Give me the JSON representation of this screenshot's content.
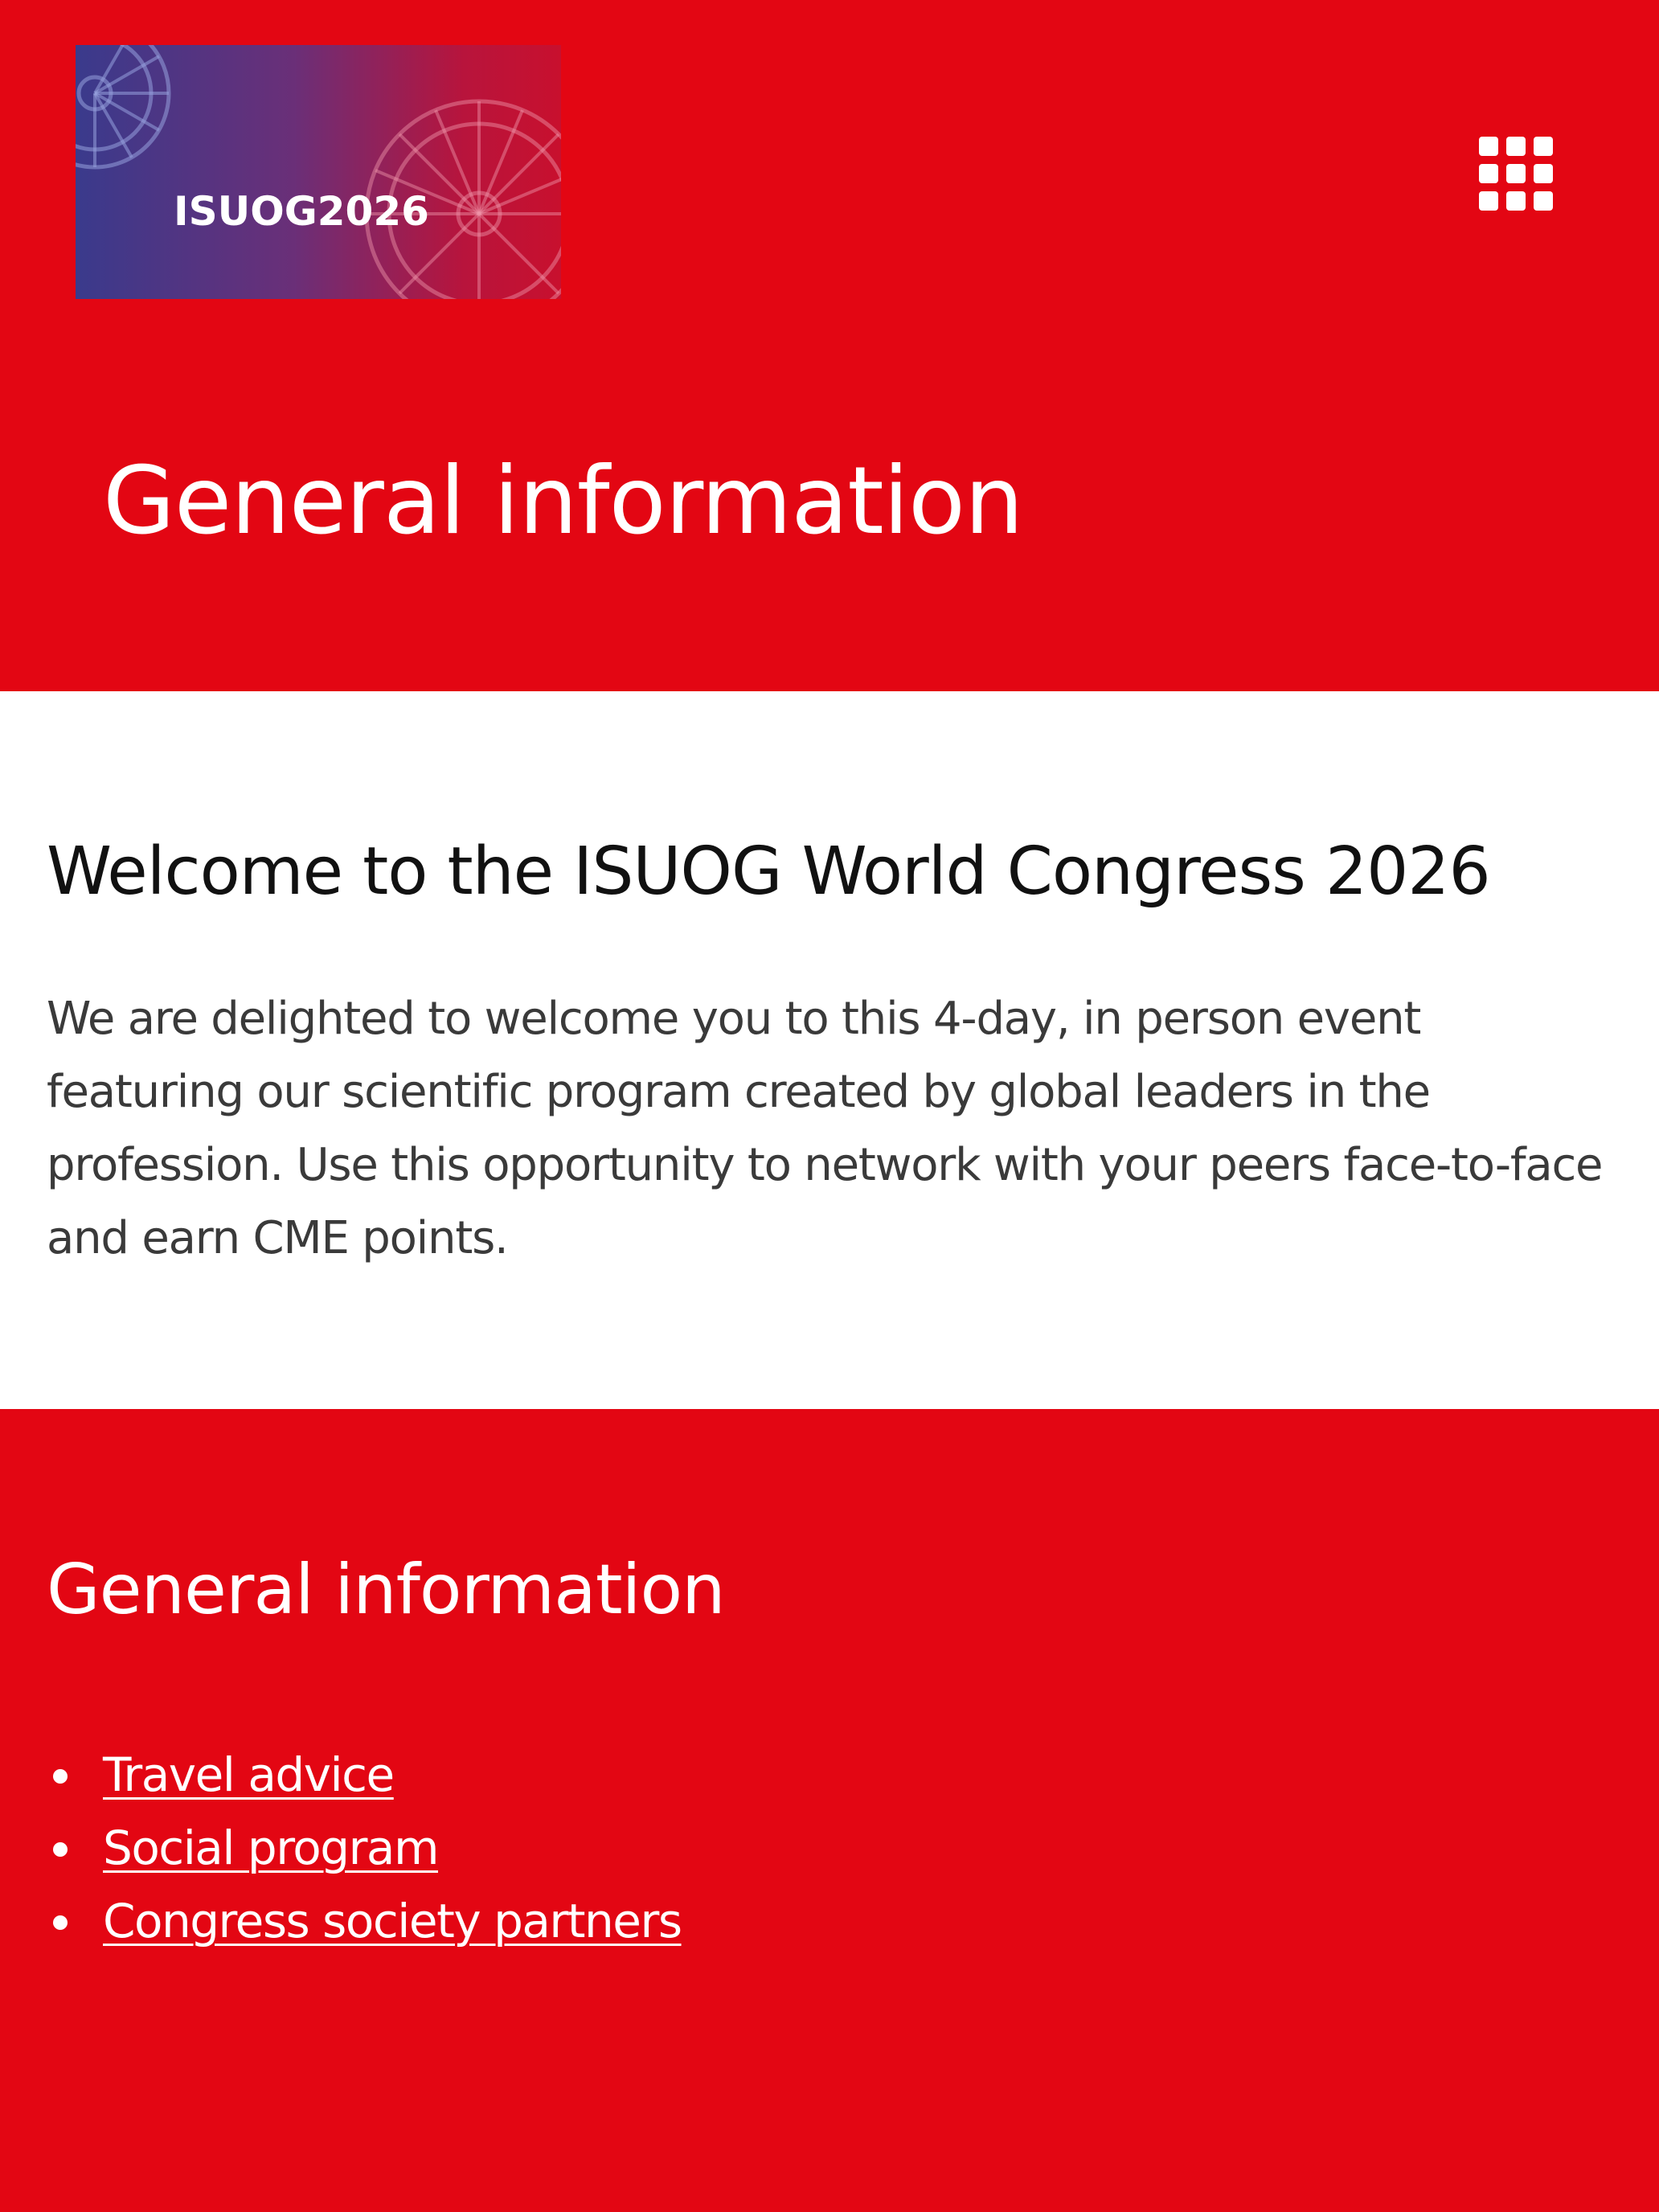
{
  "header": {
    "logo_text": "ISUOG2026",
    "menu_icon": "grid-menu-icon"
  },
  "page_title": "General information",
  "welcome": {
    "heading": "Welcome to the ISUOG World Congress 2026",
    "body": "We are delighted to welcome you to this 4-day, in person event featuring our scientific program created by global leaders in the profession. Use this opportunity to network with your peers face-to-face and earn CME points."
  },
  "info": {
    "heading": "General information",
    "links": [
      {
        "label": "Travel advice"
      },
      {
        "label": "Social program"
      },
      {
        "label": "Congress society partners"
      }
    ]
  },
  "colors": {
    "brand_red": "#e30613",
    "white": "#ffffff",
    "text_dark": "#111111",
    "text_body": "#3a3a3a"
  }
}
